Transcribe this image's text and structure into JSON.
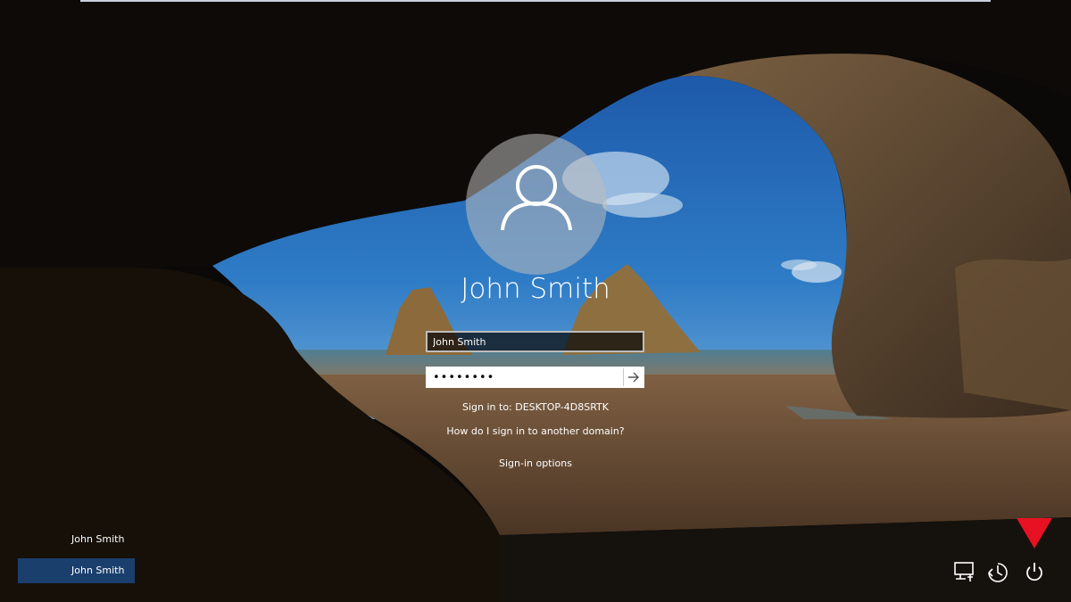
{
  "login": {
    "display_name": "John Smith",
    "username_value": "John Smith",
    "password_value": "••••••••",
    "sign_in_to": "Sign in to: DESKTOP-4D8SRTK",
    "domain_help": "How do I sign in to another domain?",
    "sign_in_options": "Sign-in options"
  },
  "user_list": [
    {
      "label": "John Smith"
    },
    {
      "label": "John Smith"
    }
  ],
  "icons": {
    "avatar": "user-avatar-icon",
    "submit": "arrow-right-icon",
    "network": "network-icon",
    "accessibility": "ease-of-access-icon",
    "power": "power-icon",
    "pointer": "red-triangle-pointer"
  },
  "colors": {
    "selected_user": "#1b3f6d",
    "pointer": "#e81123"
  }
}
